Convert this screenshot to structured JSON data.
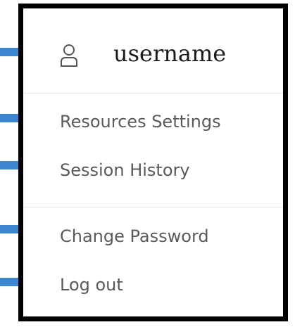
{
  "menu": {
    "username": "username",
    "user_icon": "user-icon",
    "items": [
      {
        "label": "Resources Settings"
      },
      {
        "label": "Session History"
      },
      {
        "label": "Change Password"
      },
      {
        "label": "Log out"
      }
    ]
  },
  "colors": {
    "border": "#000000",
    "marker": "#3c86cf",
    "item_text": "#5a5a5a",
    "username_text": "#1a1a1a",
    "divider": "#e3e3e3"
  }
}
